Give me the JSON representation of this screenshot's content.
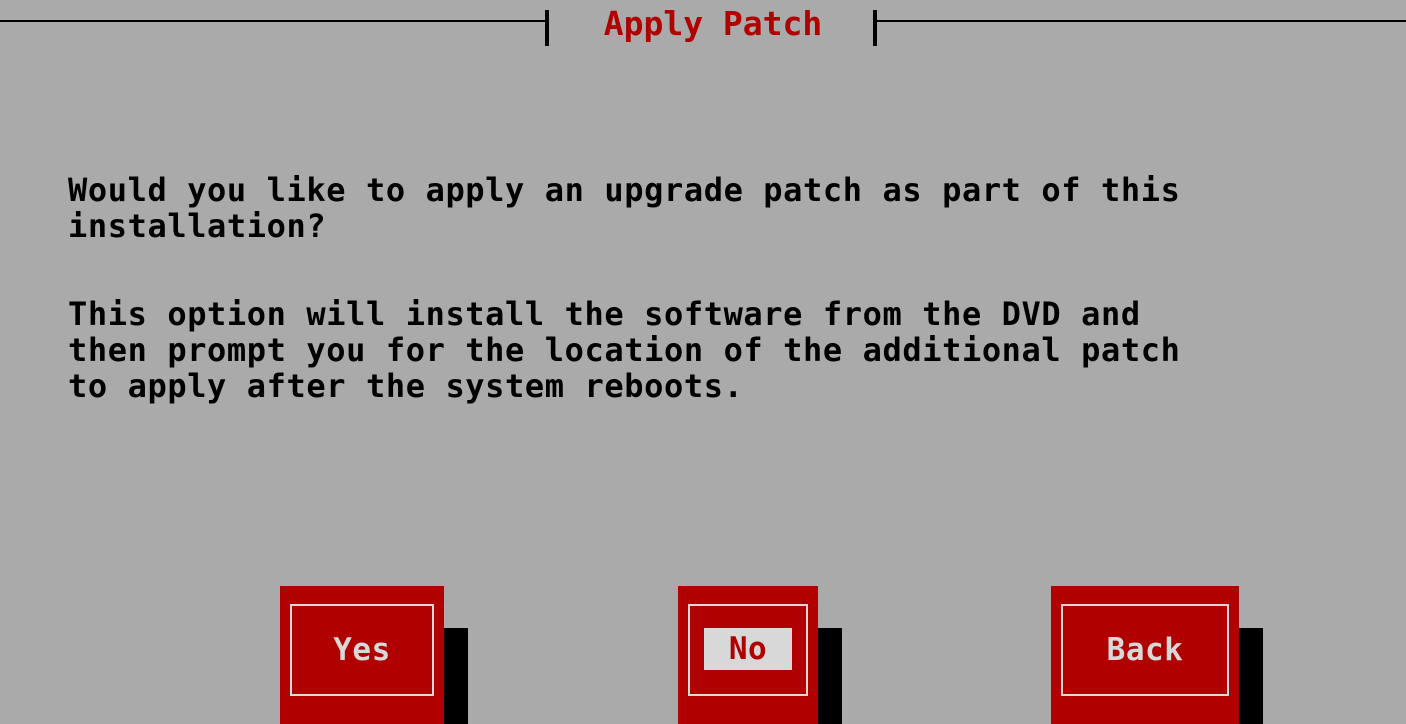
{
  "dialog": {
    "title": " Apply Patch ",
    "question": "Would you like to apply an upgrade patch as part of this\ninstallation?",
    "description": "This option will install the software from the DVD and\nthen prompt you for the location of the additional patch\nto apply after the system reboots."
  },
  "buttons": {
    "yes_label": "Yes",
    "no_label": "No",
    "back_label": "Back",
    "focused": "No"
  },
  "colors": {
    "background": "#aaaaaa",
    "accent": "#b00000",
    "button_text": "#d8d8d8",
    "shadow": "#000000"
  }
}
